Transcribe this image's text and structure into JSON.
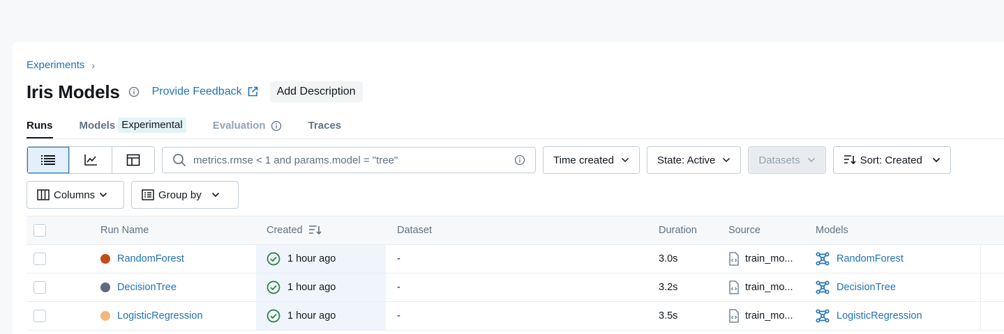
{
  "breadcrumb": {
    "label": "Experiments",
    "separator": "›"
  },
  "header": {
    "title": "Iris Models",
    "feedback_label": "Provide Feedback",
    "add_description_label": "Add Description"
  },
  "tabs": [
    {
      "label": "Runs",
      "active": true
    },
    {
      "label": "Models",
      "badge": "Experimental"
    },
    {
      "label": "Evaluation",
      "disabled": true
    },
    {
      "label": "Traces"
    }
  ],
  "toolbar": {
    "search_text": "metrics.rmse < 1 and params.model = \"tree\"",
    "time_created_label": "Time created",
    "state_label": "State: Active",
    "datasets_label": "Datasets",
    "sort_label": "Sort: Created",
    "columns_label": "Columns",
    "group_by_label": "Group by"
  },
  "table": {
    "columns": [
      "Run Name",
      "Created",
      "Dataset",
      "Duration",
      "Source",
      "Models"
    ],
    "rows": [
      {
        "run_name": "RandomForest",
        "color": "#c24e1b",
        "created": "1 hour ago",
        "dataset": "-",
        "duration": "3.0s",
        "source": "train_mo...",
        "model": "RandomForest"
      },
      {
        "run_name": "DecisionTree",
        "color": "#5f6b77",
        "created": "1 hour ago",
        "dataset": "-",
        "duration": "3.2s",
        "source": "train_mo...",
        "model": "DecisionTree"
      },
      {
        "run_name": "LogisticRegression",
        "color": "#f2b77e",
        "created": "1 hour ago",
        "dataset": "-",
        "duration": "3.5s",
        "source": "train_mo...",
        "model": "LogisticRegression"
      }
    ]
  },
  "colors": {
    "accent": "#2272b4",
    "success": "#277c43",
    "text": "#11171c",
    "muted": "#5f7281"
  }
}
